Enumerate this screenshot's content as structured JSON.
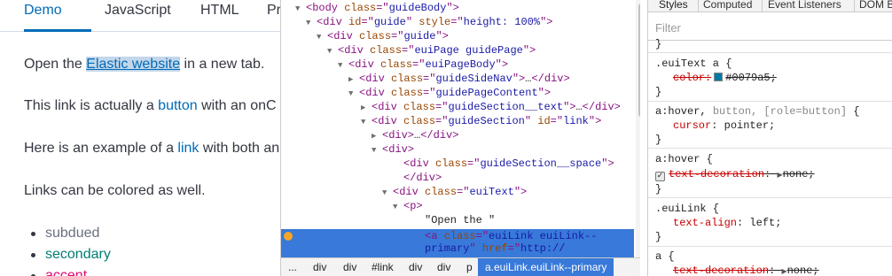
{
  "demo": {
    "tabs": [
      "Demo",
      "JavaScript",
      "HTML",
      "Pr"
    ],
    "active_tab": "Demo",
    "p1": {
      "before": "Open the ",
      "link": "Elastic website",
      "after": " in a new tab."
    },
    "p2": {
      "before": "This link is actually a ",
      "link": "button",
      "after": " with an onC"
    },
    "p3": {
      "before": "Here is an example of a ",
      "link": "link",
      "after": " with both an"
    },
    "p4": "Links can be colored as well.",
    "colors": [
      "subdued",
      "secondary",
      "accent"
    ]
  },
  "elements": {
    "lines": [
      {
        "tri": "▼",
        "parts": [
          [
            "tag",
            "<body "
          ],
          [
            "an",
            "class"
          ],
          [
            "tag",
            "=\""
          ],
          [
            "av",
            "guideBody"
          ],
          [
            "tag",
            "\">"
          ]
        ]
      },
      {
        "tri": "▼",
        "parts": [
          [
            "tag",
            "<div "
          ],
          [
            "an",
            "id"
          ],
          [
            "tag",
            "=\""
          ],
          [
            "av",
            "guide"
          ],
          [
            "tag",
            "\" "
          ],
          [
            "an",
            "style"
          ],
          [
            "tag",
            "=\""
          ],
          [
            "av",
            "height: 100%"
          ],
          [
            "tag",
            "\">"
          ]
        ]
      },
      {
        "tri": "▼",
        "parts": [
          [
            "tag",
            "<div "
          ],
          [
            "an",
            "class"
          ],
          [
            "tag",
            "=\""
          ],
          [
            "av",
            "guide"
          ],
          [
            "tag",
            "\">"
          ]
        ]
      },
      {
        "tri": "▼",
        "parts": [
          [
            "tag",
            "<div "
          ],
          [
            "an",
            "class"
          ],
          [
            "tag",
            "=\""
          ],
          [
            "av",
            "euiPage guidePage"
          ],
          [
            "tag",
            "\">"
          ]
        ]
      },
      {
        "tri": "▼",
        "parts": [
          [
            "tag",
            "<div "
          ],
          [
            "an",
            "class"
          ],
          [
            "tag",
            "=\""
          ],
          [
            "av",
            "euiPageBody"
          ],
          [
            "tag",
            "\">"
          ]
        ]
      },
      {
        "tri": "▶",
        "parts": [
          [
            "tag",
            "<div "
          ],
          [
            "an",
            "class"
          ],
          [
            "tag",
            "=\""
          ],
          [
            "av",
            "guideSideNav"
          ],
          [
            "tag",
            "\">"
          ],
          [
            "txt",
            "…"
          ],
          [
            "tag",
            "</div>"
          ]
        ]
      },
      {
        "tri": "▼",
        "parts": [
          [
            "tag",
            "<div "
          ],
          [
            "an",
            "class"
          ],
          [
            "tag",
            "=\""
          ],
          [
            "av",
            "guidePageContent"
          ],
          [
            "tag",
            "\">"
          ]
        ]
      },
      {
        "tri": "▶",
        "parts": [
          [
            "tag",
            "<div "
          ],
          [
            "an",
            "class"
          ],
          [
            "tag",
            "=\""
          ],
          [
            "av",
            "guideSection__text"
          ],
          [
            "tag",
            "\">"
          ],
          [
            "txt",
            "…"
          ],
          [
            "tag",
            "</div>"
          ]
        ]
      },
      {
        "tri": "▼",
        "parts": [
          [
            "tag",
            "<div "
          ],
          [
            "an",
            "class"
          ],
          [
            "tag",
            "=\""
          ],
          [
            "av",
            "guideSection"
          ],
          [
            "tag",
            "\" "
          ],
          [
            "an",
            "id"
          ],
          [
            "tag",
            "=\""
          ],
          [
            "av",
            "link"
          ],
          [
            "tag",
            "\">"
          ]
        ]
      },
      {
        "tri": "▶",
        "parts": [
          [
            "tag",
            "<div>"
          ],
          [
            "txt",
            "…"
          ],
          [
            "tag",
            "</div>"
          ]
        ]
      },
      {
        "tri": "▼",
        "parts": [
          [
            "tag",
            "<div>"
          ]
        ]
      },
      {
        "tri": "",
        "parts": [
          [
            "tag",
            "<div "
          ],
          [
            "an",
            "class"
          ],
          [
            "tag",
            "=\""
          ],
          [
            "av",
            "guideSection__space"
          ],
          [
            "tag",
            "\">"
          ]
        ]
      },
      {
        "tri": "",
        "parts": [
          [
            "tag",
            "</div>"
          ]
        ]
      },
      {
        "tri": "▼",
        "parts": [
          [
            "tag",
            "<div "
          ],
          [
            "an",
            "class"
          ],
          [
            "tag",
            "=\""
          ],
          [
            "av",
            "euiText"
          ],
          [
            "tag",
            "\">"
          ]
        ]
      },
      {
        "tri": "▼",
        "parts": [
          [
            "tag",
            "<p>"
          ]
        ]
      },
      {
        "tri": "",
        "parts": [
          [
            "txt",
            "\"Open the \""
          ]
        ]
      },
      {
        "tri": "",
        "parts": [
          [
            "tag",
            "<a "
          ],
          [
            "an",
            "class"
          ],
          [
            "tag",
            "=\""
          ],
          [
            "av",
            "euiLink euiLink--"
          ]
        ]
      },
      {
        "tri": "",
        "parts": [
          [
            "av",
            "primary"
          ],
          [
            "tag",
            "\" "
          ],
          [
            "an",
            "href"
          ],
          [
            "tag",
            "=\""
          ],
          [
            "av",
            "http://"
          ]
        ]
      }
    ],
    "breadcrumbs": [
      "...",
      "div",
      "div",
      "#link",
      "div",
      "div",
      "p",
      "a.euiLink.euiLink--primary"
    ]
  },
  "styles": {
    "tabs": [
      "Styles",
      "Computed",
      "Event Listeners",
      "DOM B"
    ],
    "filter_placeholder": "Filter",
    "top_fragment": "}",
    "rule1": {
      "selector": ".euiText a {",
      "prop": "color:",
      "value": "#0079a5;",
      "close": "}"
    },
    "rule2": {
      "selector_a": "a:hover, ",
      "selector_b": "button, [role=button]",
      "brace": " {",
      "prop": "cursor",
      "value": ": pointer;",
      "close": "}"
    },
    "rule3": {
      "selector": "a:hover {",
      "prop": "text-decoration",
      "value": "none;",
      "close": "}"
    },
    "rule4": {
      "selector": ".euiLink {",
      "prop": "text-align",
      "value": ": left;",
      "close": "}"
    },
    "rule5": {
      "selector": "a {",
      "prop": "text-decoration",
      "value": "none;"
    }
  },
  "colors": {
    "link": "#006bb8",
    "selection": "#3879d9",
    "swatch": "#0079a5"
  }
}
